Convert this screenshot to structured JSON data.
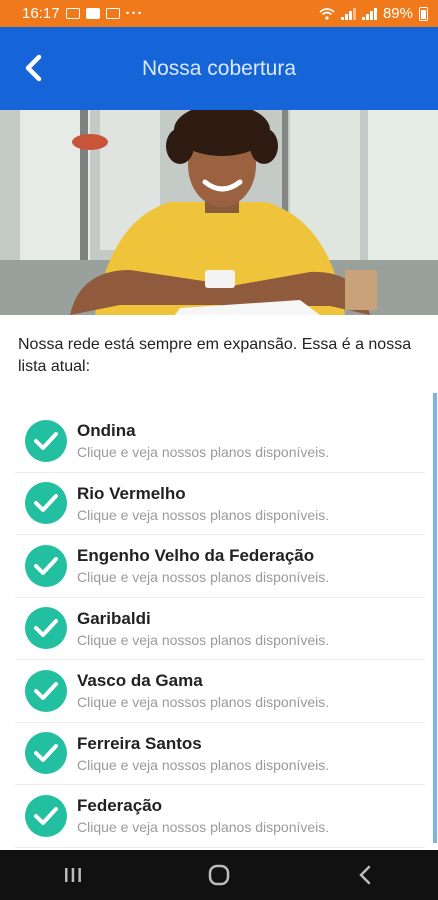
{
  "status_bar": {
    "time": "16:17",
    "dots": "···",
    "battery": "89%"
  },
  "header": {
    "title": "Nossa cobertura"
  },
  "intro": {
    "text": "Nossa rede está sempre em expansão. Essa é a nossa lista atual:"
  },
  "list": {
    "items": [
      {
        "name": "Ondina",
        "sub": "Clique e veja nossos planos disponíveis."
      },
      {
        "name": "Rio Vermelho",
        "sub": "Clique e veja nossos planos disponíveis."
      },
      {
        "name": "Engenho Velho da Federação",
        "sub": "Clique e veja nossos planos disponíveis."
      },
      {
        "name": "Garibaldi",
        "sub": "Clique e veja nossos planos disponíveis."
      },
      {
        "name": "Vasco da Gama",
        "sub": "Clique e veja nossos planos disponíveis."
      },
      {
        "name": "Ferreira Santos",
        "sub": "Clique e veja nossos planos disponíveis."
      },
      {
        "name": "Federação",
        "sub": "Clique e veja nossos planos disponíveis."
      }
    ]
  },
  "colors": {
    "status_bar": "#f07a1b",
    "header": "#1565d8",
    "check": "#22bfa0",
    "nav_bar": "#111111"
  },
  "icons": {
    "back": "chevron-left-icon",
    "check": "check-circle-icon",
    "recents": "recents-icon",
    "home": "home-icon",
    "nav_back": "back-icon"
  }
}
